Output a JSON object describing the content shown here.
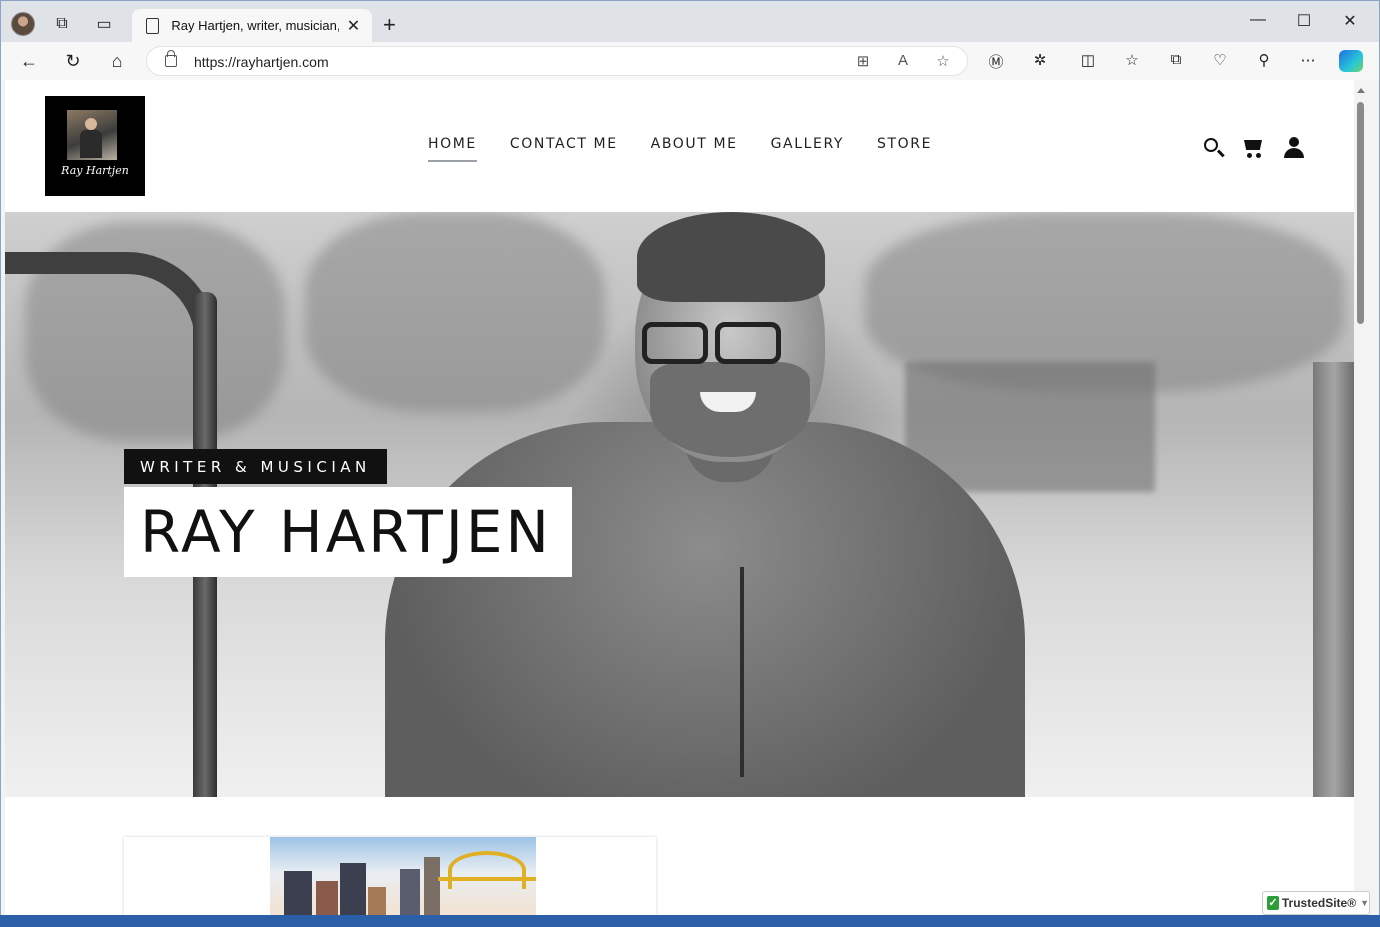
{
  "browser": {
    "tab_title": "Ray Hartjen, writer, musician, and",
    "url": "https://rayhartjen.com",
    "new_tab_glyph": "+",
    "close_glyph": "✕",
    "minimize_glyph": "—",
    "maximize_glyph": "☐",
    "window_close_glyph": "✕"
  },
  "site": {
    "logo_signature": "Ray Hartjen",
    "nav": {
      "home": "HOME",
      "contact": "CONTACT ME",
      "about": "ABOUT ME",
      "gallery": "GALLERY",
      "store": "STORE"
    },
    "hero": {
      "tagline": "WRITER & MUSICIAN",
      "title": "RAY HARTJEN"
    }
  },
  "trusted_site": {
    "label": "TrustedSite",
    "suffix": "®"
  },
  "icons": [
    "profile-avatar-icon",
    "workspaces-icon",
    "tab-actions-icon",
    "page-icon",
    "back-icon",
    "refresh-icon",
    "home-icon",
    "lock-icon",
    "apps-icon",
    "read-aloud-icon",
    "favorite-star-icon",
    "extension-m-icon",
    "extensions-icon",
    "split-screen-icon",
    "favorites-icon",
    "collections-icon",
    "browser-essentials-icon",
    "share-icon",
    "more-icon",
    "copilot-icon",
    "search-icon",
    "cart-icon",
    "account-icon"
  ]
}
